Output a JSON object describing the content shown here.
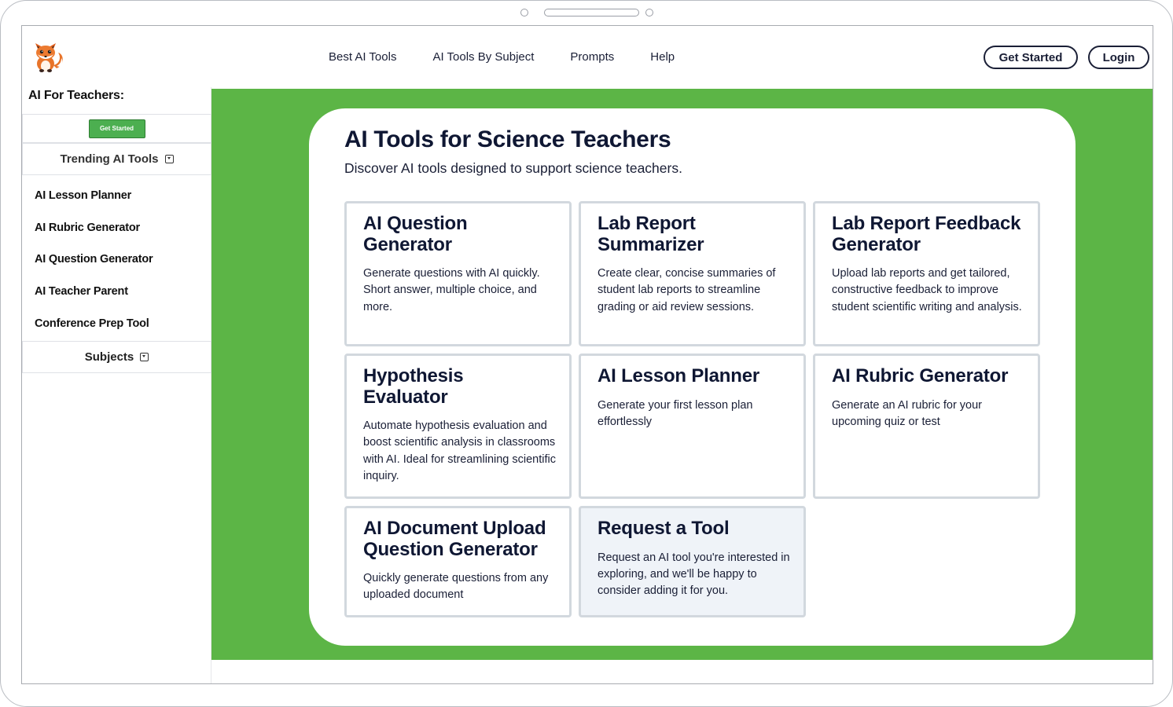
{
  "header": {
    "logo": "fox-logo-icon",
    "nav": [
      "Best AI Tools",
      "AI Tools By Subject",
      "Prompts",
      "Help"
    ],
    "get_started_label": "Get Started",
    "login_label": "Login"
  },
  "sidebar": {
    "title": "AI For Teachers:",
    "get_started_label": "Get Started",
    "trending_label": "Trending AI Tools",
    "items": [
      "AI Lesson Planner",
      "AI Rubric Generator",
      "AI Question Generator",
      "AI Teacher Parent",
      "Conference Prep Tool"
    ],
    "subjects_label": "Subjects"
  },
  "main": {
    "title": "AI Tools for Science Teachers",
    "subtitle": "Discover AI tools designed to support science teachers.",
    "tools": [
      {
        "title": "AI Question Generator",
        "desc": "Generate questions with AI quickly. Short answer, multiple choice, and more."
      },
      {
        "title": "Lab Report Summarizer",
        "desc": "Create clear, concise summaries of student lab reports to streamline grading or aid review sessions."
      },
      {
        "title": "Lab Report Feedback Generator",
        "desc": "Upload lab reports and get tailored, constructive feedback to improve student scientific writing and analysis."
      },
      {
        "title": "Hypothesis Evaluator",
        "desc": "Automate hypothesis evaluation and boost scientific analysis in classrooms with AI. Ideal for streamlining scientific inquiry."
      },
      {
        "title": "AI Lesson Planner",
        "desc": "Generate your first lesson plan effortlessly"
      },
      {
        "title": "AI Rubric Generator",
        "desc": "Generate an AI rubric for your upcoming quiz or test"
      },
      {
        "title": "AI Document Upload Question Generator",
        "desc": "Quickly generate questions from any uploaded document"
      },
      {
        "title": "Request a Tool",
        "desc": "Request an AI tool you're interested in exploring, and we'll be happy to consider adding it for you."
      }
    ]
  },
  "colors": {
    "main_bg": "#5cb546",
    "sidebar_button": "#4caf50",
    "text_dark": "#0f1733",
    "card_border": "#d2d8de",
    "request_card_bg": "#eff3f8"
  }
}
